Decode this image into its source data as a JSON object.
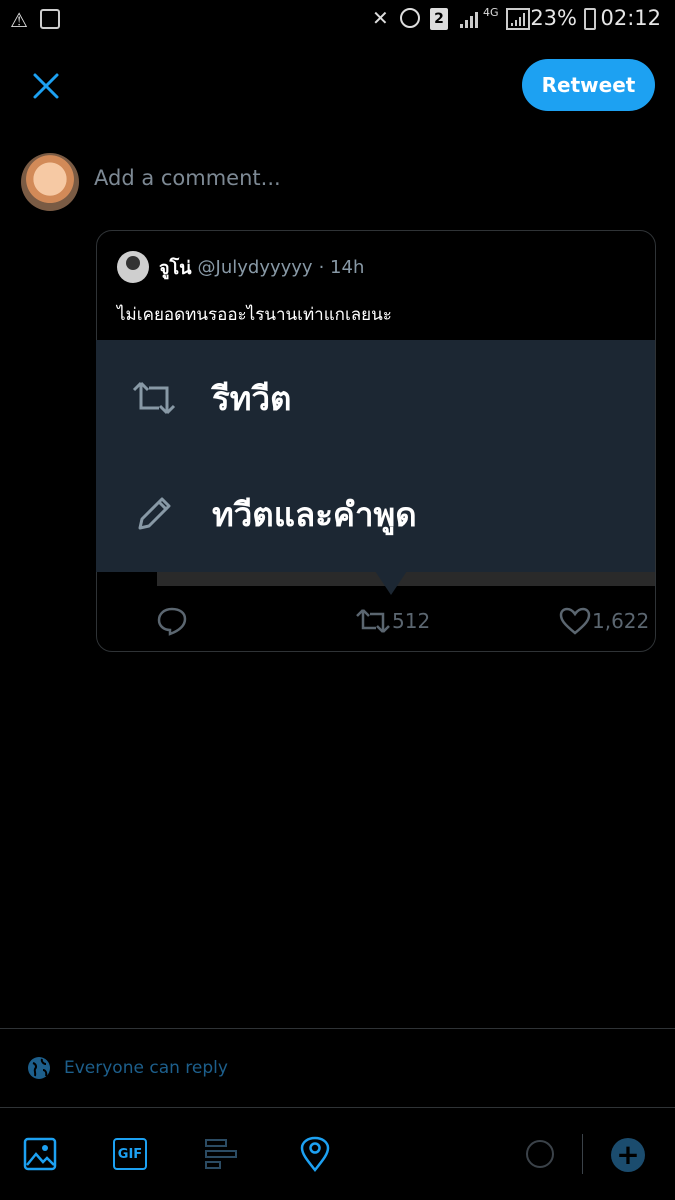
{
  "status_bar": {
    "battery_percent": "23%",
    "time": "02:12",
    "sim_badge": "2",
    "network": "4G"
  },
  "header": {
    "retweet_label": "Retweet"
  },
  "composer": {
    "placeholder": "Add a comment..."
  },
  "quoted_tweet": {
    "author_name": "จูโน่",
    "author_handle": "@Julydyyyyy",
    "time": "· 14h",
    "text": "ไม่เคยอดทนรออะไรนานเท่าแกเลยนะ",
    "reply_count": "",
    "retweet_count": "512",
    "like_count": "1,622"
  },
  "retweet_menu": {
    "items": [
      {
        "label": "รีทวีต",
        "icon": "retweet-icon"
      },
      {
        "label": "ทวีตและคำพูด",
        "icon": "pencil-icon"
      }
    ]
  },
  "reply_settings": {
    "label": "Everyone can reply"
  },
  "toolbar": {
    "gif_label": "GIF",
    "add_label": "+"
  },
  "colors": {
    "accent": "#1da1f2",
    "menu_bg": "#1c2733",
    "muted": "#5b6670"
  }
}
